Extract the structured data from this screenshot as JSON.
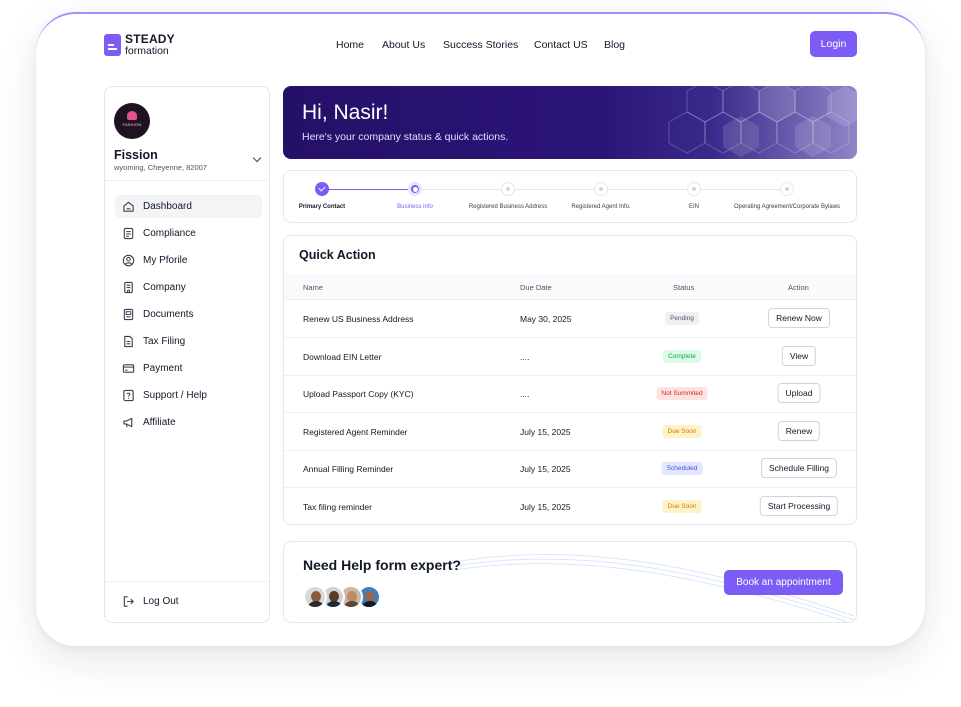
{
  "brand": {
    "name_top": "STEADY",
    "name_bottom": "formation"
  },
  "nav": [
    "Home",
    "About Us",
    "Success Stories",
    "Contact US",
    "Blog"
  ],
  "login_label": "Login",
  "company": {
    "name": "Fission",
    "address": "wyoming, Cheyenne, 82007",
    "logo_text": "FASHION"
  },
  "sidebar": {
    "items": [
      {
        "label": "Dashboard",
        "icon": "home-icon",
        "active": true
      },
      {
        "label": "Compliance",
        "icon": "document-icon"
      },
      {
        "label": "My Pforile",
        "icon": "user-icon"
      },
      {
        "label": "Company",
        "icon": "building-icon"
      },
      {
        "label": "Documents",
        "icon": "folder-icon"
      },
      {
        "label": "Tax Filing",
        "icon": "file-icon"
      },
      {
        "label": "Payment",
        "icon": "card-icon"
      },
      {
        "label": "Support / Help",
        "icon": "help-icon"
      },
      {
        "label": "Affiliate",
        "icon": "megaphone-icon"
      }
    ],
    "logout_label": "Log Out"
  },
  "banner": {
    "greeting": "Hi, Nasir!",
    "subtitle": "Here's your company status & quick actions."
  },
  "stepper": {
    "steps": [
      {
        "label": "Primary Contact",
        "state": "done"
      },
      {
        "label": "Business info",
        "state": "current"
      },
      {
        "label": "Registered Business Address",
        "state": "todo"
      },
      {
        "label": "Registered Agent Info.",
        "state": "todo"
      },
      {
        "label": "EIN",
        "state": "todo"
      },
      {
        "label": "Operating Agreement/Corporate Bylaws",
        "state": "todo"
      }
    ]
  },
  "quick_action": {
    "title": "Quick Action",
    "columns": [
      "Name",
      "Due Date",
      "Status",
      "Action"
    ],
    "rows": [
      {
        "name": "Renew US Business Address",
        "due": "May 30, 2025",
        "status": "Pending",
        "action": "Renew Now"
      },
      {
        "name": "Download EIN Letter",
        "due": "....",
        "status": "Complete",
        "action": "View"
      },
      {
        "name": "Upload Passport Copy (KYC)",
        "due": "....",
        "status": "Not Summited",
        "action": "Upload"
      },
      {
        "name": "Registered Agent Reminder",
        "due": "July 15, 2025",
        "status": "Due Soon",
        "action": "Renew"
      },
      {
        "name": "Annual Filling Reminder",
        "due": "July 15, 2025",
        "status": "Scheduled",
        "action": "Schedule Filling"
      },
      {
        "name": "Tax filing reminder",
        "due": "July 15, 2025",
        "status": "Due Soon",
        "action": "Start Processing"
      }
    ]
  },
  "status_colors": {
    "Pending": {
      "bg": "#eef0f4",
      "fg": "#4b5563"
    },
    "Complete": {
      "bg": "#dcfce7",
      "fg": "#16a34a"
    },
    "Not Summited": {
      "bg": "#fee2e2",
      "fg": "#dc2626"
    },
    "Due Soon": {
      "bg": "#fef3c7",
      "fg": "#d97706"
    },
    "Scheduled": {
      "bg": "#e0e7ff",
      "fg": "#4f46e5"
    }
  },
  "help": {
    "title": "Need Help form expert?",
    "button": "Book an appointment"
  },
  "colors": {
    "accent": "#7c5cf5",
    "banner": "#251068"
  }
}
